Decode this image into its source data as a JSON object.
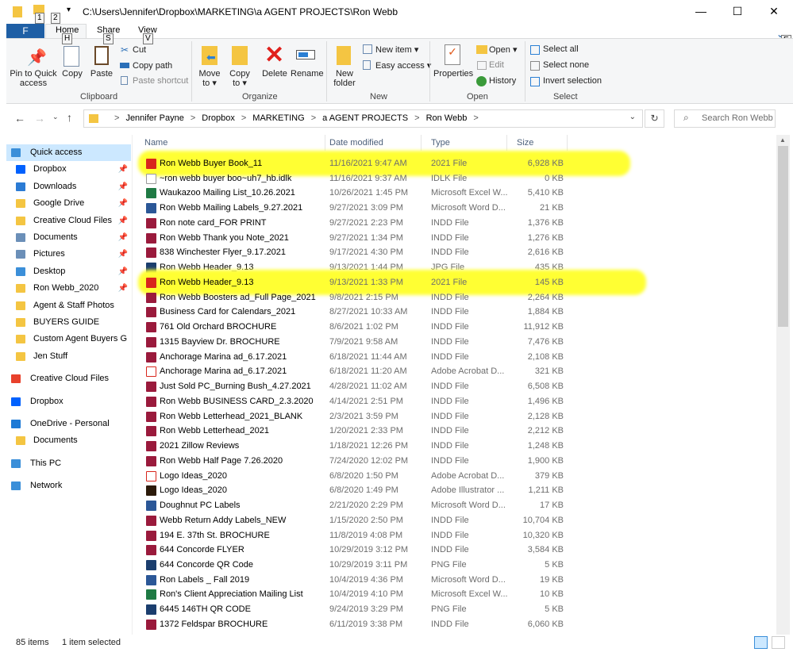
{
  "window": {
    "path": "C:\\Users\\Jennifer\\Dropbox\\MARKETING\\a AGENT PROJECTS\\Ron Webb",
    "minimize": "—",
    "maximize": "☐",
    "close": "✕",
    "qat_keys": [
      "1",
      "2"
    ]
  },
  "tabs": {
    "file": "F",
    "home": "Home",
    "share": "Share",
    "view": "View",
    "keys": {
      "home": "H",
      "share": "S",
      "view": "V",
      "help": "E"
    }
  },
  "ribbon": {
    "clipboard": {
      "label": "Clipboard",
      "pin": "Pin to Quick access",
      "copy": "Copy",
      "paste": "Paste",
      "cut": "Cut",
      "copy_path": "Copy path",
      "paste_shortcut": "Paste shortcut"
    },
    "organize": {
      "label": "Organize",
      "move_to": "Move to ▾",
      "copy_to": "Copy to ▾",
      "delete": "Delete",
      "rename": "Rename"
    },
    "new": {
      "label": "New",
      "new_folder": "New folder",
      "new_item": "New item ▾",
      "easy_access": "Easy access ▾"
    },
    "open": {
      "label": "Open",
      "properties": "Properties",
      "open": "Open ▾",
      "edit": "Edit",
      "history": "History"
    },
    "select": {
      "label": "Select",
      "select_all": "Select all",
      "select_none": "Select none",
      "invert": "Invert selection"
    }
  },
  "address": {
    "crumbs": [
      "Jennifer Payne",
      "Dropbox",
      "MARKETING",
      "a AGENT PROJECTS",
      "Ron Webb"
    ],
    "search_placeholder": "Search Ron Webb"
  },
  "nav": [
    {
      "label": "Quick access",
      "color": "#3b8fd9",
      "sel": true
    },
    {
      "label": "Dropbox",
      "color": "#0061fe",
      "pin": true,
      "indent": 1
    },
    {
      "label": "Downloads",
      "color": "#2b7bd4",
      "pin": true,
      "indent": 1
    },
    {
      "label": "Google Drive",
      "color": "#f4c542",
      "pin": true,
      "indent": 1
    },
    {
      "label": "Creative Cloud Files",
      "color": "#f4c542",
      "pin": true,
      "indent": 1
    },
    {
      "label": "Documents",
      "color": "#6b8fb8",
      "pin": true,
      "indent": 1
    },
    {
      "label": "Pictures",
      "color": "#6b8fb8",
      "pin": true,
      "indent": 1
    },
    {
      "label": "Desktop",
      "color": "#3b8fd9",
      "pin": true,
      "indent": 1
    },
    {
      "label": "Ron Webb_2020",
      "color": "#f4c542",
      "pin": true,
      "indent": 1
    },
    {
      "label": "Agent & Staff Photos",
      "color": "#f4c542",
      "indent": 1
    },
    {
      "label": "BUYERS GUIDE",
      "color": "#f4c542",
      "indent": 1
    },
    {
      "label": "Custom Agent Buyers G",
      "color": "#f4c542",
      "indent": 1
    },
    {
      "label": "Jen Stuff",
      "color": "#f4c542",
      "indent": 1
    },
    {
      "label": "Creative Cloud Files",
      "color": "#e8412c",
      "gap": true
    },
    {
      "label": "Dropbox",
      "color": "#0061fe",
      "gap": true
    },
    {
      "label": "OneDrive - Personal",
      "color": "#1e7ad6",
      "gap": true
    },
    {
      "label": "Documents",
      "color": "#f4c542",
      "indent": 1
    },
    {
      "label": "This PC",
      "color": "#3b8fd9",
      "gap": true
    },
    {
      "label": "Network",
      "color": "#3b8fd9",
      "gap": true
    }
  ],
  "columns": {
    "name": "Name",
    "date": "Date modified",
    "type": "Type",
    "size": "Size"
  },
  "icon_colors": {
    "pdf2021": "#d8261c",
    "blank": "#ffffff",
    "excel": "#1f7a44",
    "word": "#2b5797",
    "indd": "#9a1a3c",
    "jpg": "#1b3e6e",
    "acrobat": "#ffffff",
    "ai": "#2b1a0a",
    "png": "#1b3e6e"
  },
  "files": [
    {
      "name": "Ron Webb Buyer Book_11",
      "date": "11/16/2021 9:47 AM",
      "type": "2021 File",
      "size": "6,928 KB",
      "icon": "pdf2021",
      "highlight": true
    },
    {
      "name": "~ron webb buyer boo~uh7_hb.idlk",
      "date": "11/16/2021 9:37 AM",
      "type": "IDLK File",
      "size": "0 KB",
      "icon": "blank"
    },
    {
      "name": "Waukazoo Mailing List_10.26.2021",
      "date": "10/26/2021 1:45 PM",
      "type": "Microsoft Excel W...",
      "size": "5,410 KB",
      "icon": "excel"
    },
    {
      "name": "Ron Webb Mailing Labels_9.27.2021",
      "date": "9/27/2021 3:09 PM",
      "type": "Microsoft Word D...",
      "size": "21 KB",
      "icon": "word"
    },
    {
      "name": "Ron note card_FOR PRINT",
      "date": "9/27/2021 2:23 PM",
      "type": "INDD File",
      "size": "1,376 KB",
      "icon": "indd"
    },
    {
      "name": "Ron Webb Thank you Note_2021",
      "date": "9/27/2021 1:34 PM",
      "type": "INDD File",
      "size": "1,276 KB",
      "icon": "indd"
    },
    {
      "name": "838 Winchester Flyer_9.17.2021",
      "date": "9/17/2021 4:30 PM",
      "type": "INDD File",
      "size": "2,616 KB",
      "icon": "indd"
    },
    {
      "name": "Ron Webb Header_9.13",
      "date": "9/13/2021 1:44 PM",
      "type": "JPG File",
      "size": "435 KB",
      "icon": "jpg"
    },
    {
      "name": "Ron Webb Header_9.13",
      "date": "9/13/2021 1:33 PM",
      "type": "2021 File",
      "size": "145 KB",
      "icon": "pdf2021",
      "highlight": true
    },
    {
      "name": "Ron Webb Boosters ad_Full Page_2021",
      "date": "9/8/2021 2:15 PM",
      "type": "INDD File",
      "size": "2,264 KB",
      "icon": "indd"
    },
    {
      "name": "Business Card for Calendars_2021",
      "date": "8/27/2021 10:33 AM",
      "type": "INDD File",
      "size": "1,884 KB",
      "icon": "indd"
    },
    {
      "name": "761 Old Orchard BROCHURE",
      "date": "8/6/2021 1:02 PM",
      "type": "INDD File",
      "size": "11,912 KB",
      "icon": "indd"
    },
    {
      "name": "1315 Bayview Dr. BROCHURE",
      "date": "7/9/2021 9:58 AM",
      "type": "INDD File",
      "size": "7,476 KB",
      "icon": "indd"
    },
    {
      "name": "Anchorage Marina ad_6.17.2021",
      "date": "6/18/2021 11:44 AM",
      "type": "INDD File",
      "size": "2,108 KB",
      "icon": "indd"
    },
    {
      "name": "Anchorage Marina ad_6.17.2021",
      "date": "6/18/2021 11:20 AM",
      "type": "Adobe Acrobat D...",
      "size": "321 KB",
      "icon": "acrobat"
    },
    {
      "name": "Just Sold PC_Burning Bush_4.27.2021",
      "date": "4/28/2021 11:02 AM",
      "type": "INDD File",
      "size": "6,508 KB",
      "icon": "indd"
    },
    {
      "name": "Ron Webb BUSINESS CARD_2.3.2020",
      "date": "4/14/2021 2:51 PM",
      "type": "INDD File",
      "size": "1,496 KB",
      "icon": "indd"
    },
    {
      "name": "Ron Webb Letterhead_2021_BLANK",
      "date": "2/3/2021 3:59 PM",
      "type": "INDD File",
      "size": "2,128 KB",
      "icon": "indd"
    },
    {
      "name": "Ron Webb Letterhead_2021",
      "date": "1/20/2021 2:33 PM",
      "type": "INDD File",
      "size": "2,212 KB",
      "icon": "indd"
    },
    {
      "name": "2021 Zillow Reviews",
      "date": "1/18/2021 12:26 PM",
      "type": "INDD File",
      "size": "1,248 KB",
      "icon": "indd"
    },
    {
      "name": "Ron Webb Half Page 7.26.2020",
      "date": "7/24/2020 12:02 PM",
      "type": "INDD File",
      "size": "1,900 KB",
      "icon": "indd"
    },
    {
      "name": "Logo Ideas_2020",
      "date": "6/8/2020 1:50 PM",
      "type": "Adobe Acrobat D...",
      "size": "379 KB",
      "icon": "acrobat"
    },
    {
      "name": "Logo Ideas_2020",
      "date": "6/8/2020 1:49 PM",
      "type": "Adobe Illustrator ...",
      "size": "1,211 KB",
      "icon": "ai"
    },
    {
      "name": "Doughnut PC Labels",
      "date": "2/21/2020 2:29 PM",
      "type": "Microsoft Word D...",
      "size": "17 KB",
      "icon": "word"
    },
    {
      "name": "Webb Return Addy Labels_NEW",
      "date": "1/15/2020 2:50 PM",
      "type": "INDD File",
      "size": "10,704 KB",
      "icon": "indd"
    },
    {
      "name": "194 E. 37th St. BROCHURE",
      "date": "11/8/2019 4:08 PM",
      "type": "INDD File",
      "size": "10,320 KB",
      "icon": "indd"
    },
    {
      "name": "644 Concorde FLYER",
      "date": "10/29/2019 3:12 PM",
      "type": "INDD File",
      "size": "3,584 KB",
      "icon": "indd"
    },
    {
      "name": "644 Concorde QR Code",
      "date": "10/29/2019 3:11 PM",
      "type": "PNG File",
      "size": "5 KB",
      "icon": "png"
    },
    {
      "name": "Ron Labels _ Fall 2019",
      "date": "10/4/2019 4:36 PM",
      "type": "Microsoft Word D...",
      "size": "19 KB",
      "icon": "word"
    },
    {
      "name": "Ron's Client Appreciation Mailing List",
      "date": "10/4/2019 4:10 PM",
      "type": "Microsoft Excel W...",
      "size": "10 KB",
      "icon": "excel"
    },
    {
      "name": "6445 146TH QR CODE",
      "date": "9/24/2019 3:29 PM",
      "type": "PNG File",
      "size": "5 KB",
      "icon": "png"
    },
    {
      "name": "1372 Feldspar BROCHURE",
      "date": "6/11/2019 3:38 PM",
      "type": "INDD File",
      "size": "6,060 KB",
      "icon": "indd"
    }
  ],
  "status": {
    "count": "85 items",
    "selected": "1 item selected"
  }
}
